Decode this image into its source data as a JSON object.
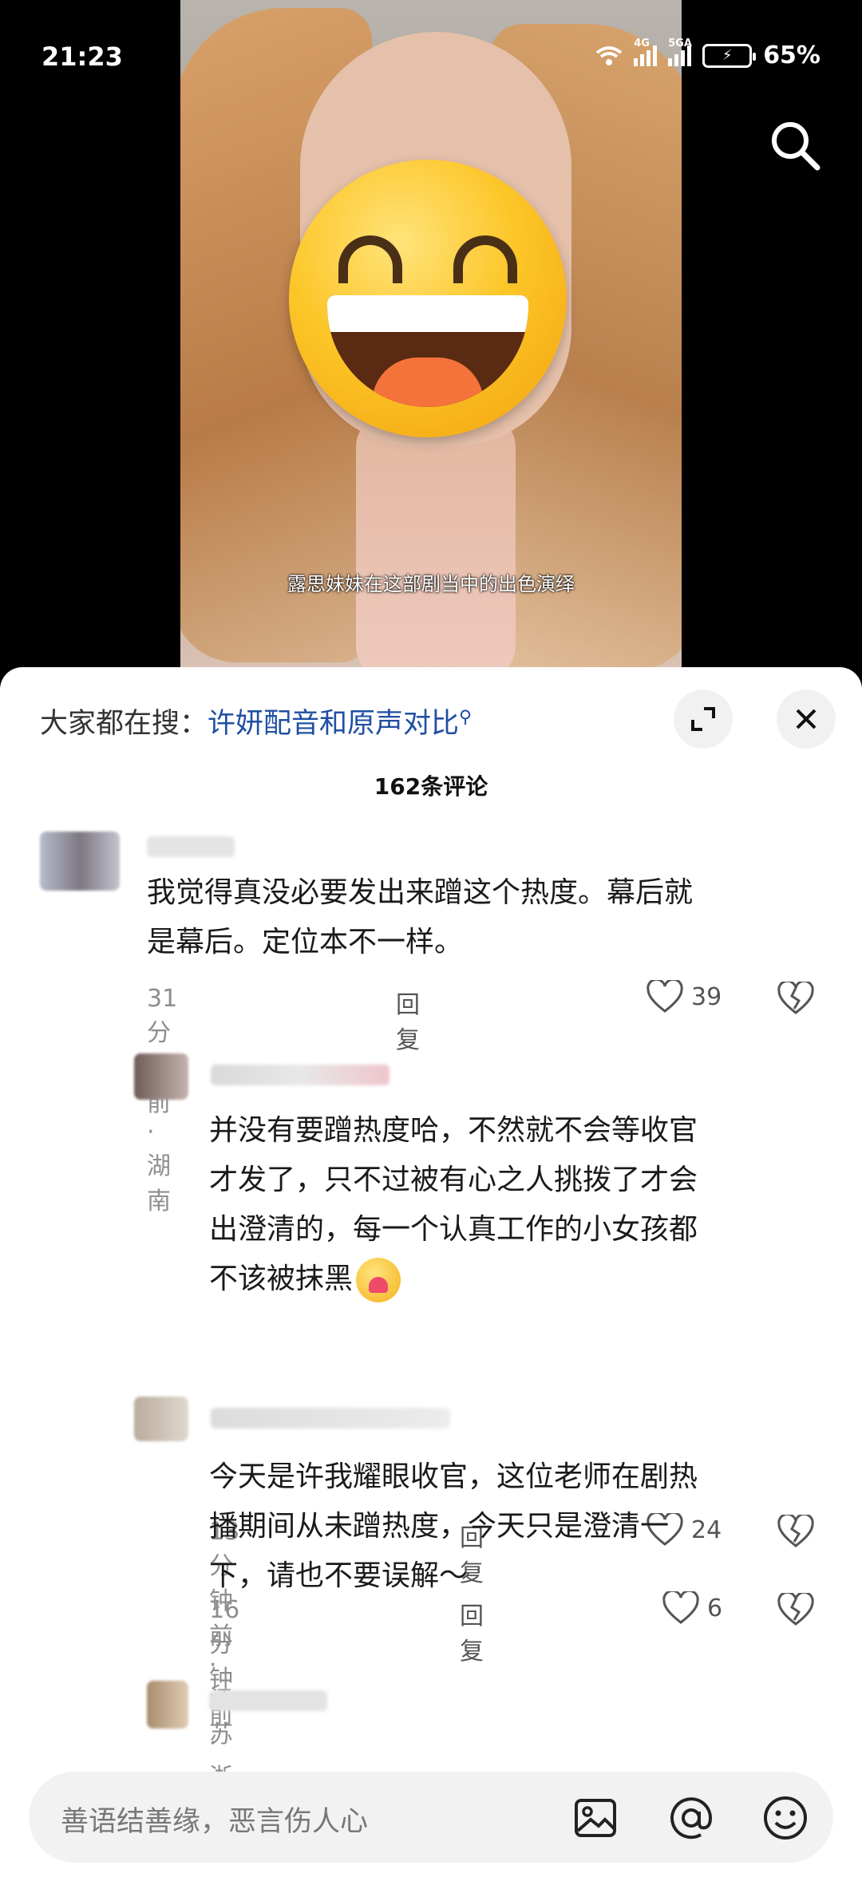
{
  "status_bar": {
    "time": "21:23",
    "net1": "4G",
    "net2": "5GA",
    "battery": "65%"
  },
  "video": {
    "subtitle": "露思妹妹在这部剧当中的出色演绎"
  },
  "panel": {
    "hot_search_prefix": "大家都在搜：",
    "hot_search_term": "许妍配音和原声对比",
    "comment_count": "162条评论"
  },
  "comments": [
    {
      "text_lines": [
        "我觉得真没必要发出来蹭这个热度。幕后就",
        "是幕后。定位本不一样。"
      ],
      "meta": "31分钟前 · 湖南",
      "reply": "回复",
      "likes": "39"
    },
    {
      "text_lines": [
        "并没有要蹭热度哈，不然就不会等收官",
        "才发了，只不过被有心之人挑拨了才会",
        "出澄清的，每一个认真工作的小女孩都",
        "不该被抹黑"
      ],
      "meta": "13分钟前 · 江苏",
      "reply": "回复",
      "likes": "24"
    },
    {
      "text_lines": [
        "今天是许我耀眼收官，这位老师在剧热",
        "播期间从未蹭热度，今天只是澄清一",
        "下，请也不要误解～"
      ],
      "meta": "16分钟前 · 浙江",
      "reply": "回复",
      "likes": "6"
    }
  ],
  "input": {
    "placeholder": "善语结善缘，恶言伤人心"
  },
  "icons": {
    "search": "search-icon",
    "expand": "expand-icon",
    "close": "close-icon",
    "like": "heart-icon",
    "dislike": "broken-heart-icon",
    "image": "image-icon",
    "mention": "at-icon",
    "emoji": "emoji-icon"
  },
  "colors": {
    "hot_search": "#1f4fa3",
    "panel_bg": "#ffffff",
    "meta": "#8e8e8e"
  }
}
